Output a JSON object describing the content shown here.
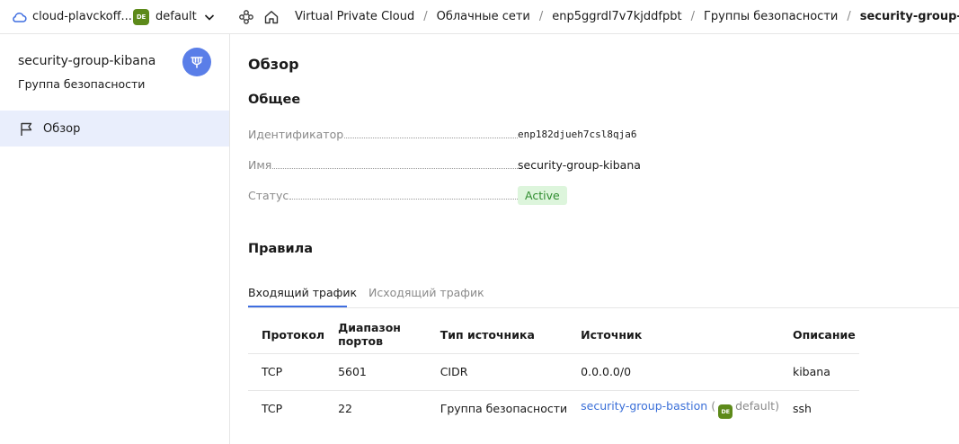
{
  "topbar": {
    "cloud_name": "cloud-plavckoff...",
    "folder_badge": "DE",
    "folder_name": "default",
    "breadcrumbs": [
      "Virtual Private Cloud",
      "Облачные сети",
      "enp5ggrdl7v7kjddfpbt",
      "Группы безопасности",
      "security-group-kibana"
    ],
    "separator": "/"
  },
  "sidebar": {
    "title": "security-group-kibana",
    "subtitle": "Группа безопасности",
    "items": [
      {
        "label": "Обзор",
        "icon": "flag-icon",
        "active": true
      }
    ]
  },
  "main": {
    "page_title": "Обзор",
    "general": {
      "heading": "Общее",
      "rows": [
        {
          "key": "Идентификатор",
          "value": "enp182djueh7csl8qja6"
        },
        {
          "key": "Имя",
          "value": "security-group-kibana"
        },
        {
          "key": "Статус",
          "value": "Active"
        }
      ]
    },
    "rules": {
      "heading": "Правила",
      "tabs": [
        {
          "label": "Входящий трафик",
          "active": true
        },
        {
          "label": "Исходящий трафик",
          "active": false
        }
      ],
      "columns": [
        "Протокол",
        "Диапазон портов",
        "Тип источника",
        "Источник",
        "Описание"
      ],
      "rows": [
        {
          "protocol": "TCP",
          "ports": "5601",
          "source_type": "CIDR",
          "source": "0.0.0.0/0",
          "description": "kibana"
        },
        {
          "protocol": "TCP",
          "ports": "22",
          "source_type": "Группа безопасности",
          "source": "security-group-bastion",
          "source_badge": "DE",
          "source_folder": "default",
          "paren_open": "(",
          "paren_close": ")",
          "description": "ssh"
        }
      ]
    }
  },
  "colors": {
    "accent": "#3f6ee0",
    "active_bg": "#e9eefc",
    "status_bg": "#ddf5dc",
    "status_text": "#2f8c2f",
    "folder_badge_bg": "#5d8a1a",
    "avatar_bg": "#5a7ee8"
  }
}
